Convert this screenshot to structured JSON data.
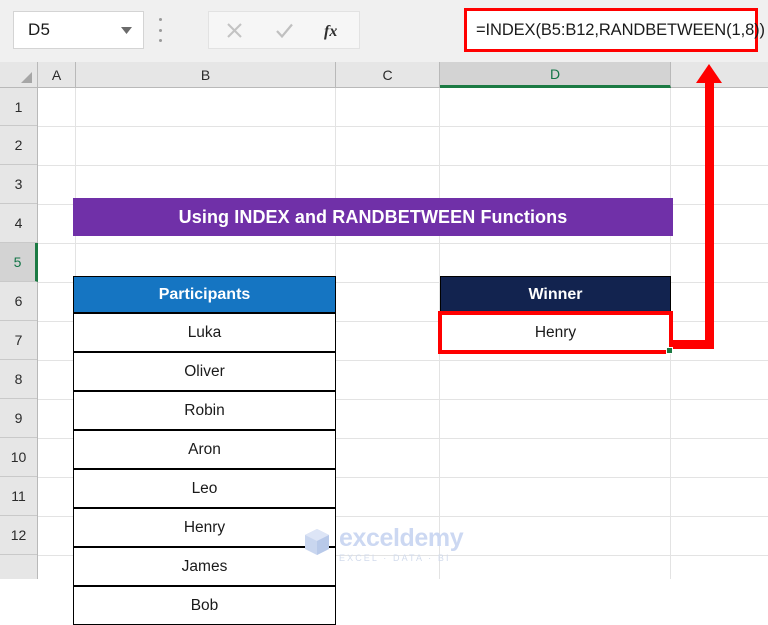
{
  "formula_bar": {
    "name_box_value": "D5",
    "name_box_dropdown_icon": "chevron-down-icon",
    "more_icon": "vertical-dots-icon",
    "cancel_icon": "cancel-x-icon",
    "enter_icon": "enter-check-icon",
    "function_icon": "fx-insert-function-icon",
    "formula": "=INDEX(B5:B12,RANDBETWEEN(1,8))"
  },
  "grid": {
    "columns": [
      "A",
      "B",
      "C",
      "D"
    ],
    "selected_column": "D",
    "rows": [
      "1",
      "2",
      "3",
      "4",
      "5",
      "6",
      "7",
      "8",
      "9",
      "10",
      "11",
      "12"
    ],
    "selected_row": "5"
  },
  "sheet": {
    "title_banner": "Using INDEX and RANDBETWEEN Functions",
    "participants_header": "Participants",
    "participants": [
      "Luka",
      "Oliver",
      "Robin",
      "Aron",
      "Leo",
      "Henry",
      "James",
      "Bob"
    ],
    "winner_header": "Winner",
    "winner_value": "Henry"
  },
  "colors": {
    "banner_purple": "#7030a8",
    "participants_blue": "#1575c2",
    "winner_navy": "#12234f",
    "annotation_red": "#ff0000",
    "selection_green": "#1b7a43"
  },
  "watermark": {
    "name": "exceldemy",
    "tagline": "EXCEL · DATA · BI",
    "logo_icon": "exceldemy-cube-logo-icon"
  }
}
